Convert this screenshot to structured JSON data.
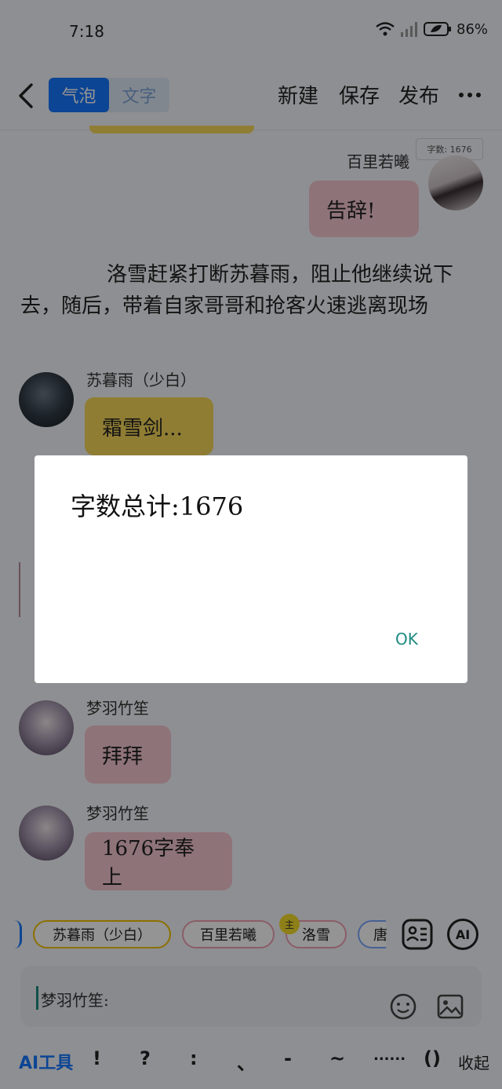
{
  "status_bar": {
    "time": "7:18",
    "battery": "86%"
  },
  "header": {
    "tabs": [
      "气泡",
      "文字"
    ],
    "actions": {
      "new": "新建",
      "save": "保存",
      "publish": "发布"
    },
    "word_count_badge": "字数: 1676"
  },
  "chat": {
    "msg1": {
      "name": "百里若曦",
      "text": "告辞!"
    },
    "narration": "洛雪赶紧打断苏暮雨，阻止他继续说下去，随后，带着自家哥哥和抢客火速逃离现场",
    "msg2": {
      "name": "苏暮雨（少白）",
      "text": "霜雪剑..."
    },
    "msg3": {
      "name": "梦羽竹笙",
      "text": "拜拜"
    },
    "msg4": {
      "name": "梦羽竹笙",
      "text": "1676字奉上"
    }
  },
  "roles": {
    "chips": [
      "苏暮雨（少白）",
      "百里若曦",
      "洛雪",
      "唐"
    ],
    "main_badge": "主",
    "ai_label": "AI"
  },
  "input": {
    "prefix": "梦羽竹笙:"
  },
  "toolbar": {
    "ai_tools": "AI工具",
    "symbols": [
      "!",
      "?",
      ":",
      "、",
      "-",
      "~",
      "......",
      "()"
    ],
    "collapse": "收起"
  },
  "dialog": {
    "message": "字数总计:1676",
    "ok_label": "OK"
  },
  "colors": {
    "accent": "#1677ff",
    "pink_bubble": "#f4c6d1",
    "yellow_bubble": "#f7d85a",
    "ok_text": "#1d8a80"
  }
}
